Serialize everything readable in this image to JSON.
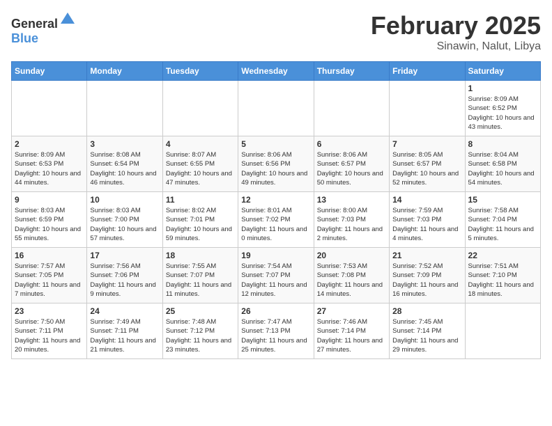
{
  "header": {
    "logo_general": "General",
    "logo_blue": "Blue",
    "month_year": "February 2025",
    "location": "Sinawin, Nalut, Libya"
  },
  "weekdays": [
    "Sunday",
    "Monday",
    "Tuesday",
    "Wednesday",
    "Thursday",
    "Friday",
    "Saturday"
  ],
  "weeks": [
    [
      {
        "day": "",
        "info": ""
      },
      {
        "day": "",
        "info": ""
      },
      {
        "day": "",
        "info": ""
      },
      {
        "day": "",
        "info": ""
      },
      {
        "day": "",
        "info": ""
      },
      {
        "day": "",
        "info": ""
      },
      {
        "day": "1",
        "info": "Sunrise: 8:09 AM\nSunset: 6:52 PM\nDaylight: 10 hours and 43 minutes."
      }
    ],
    [
      {
        "day": "2",
        "info": "Sunrise: 8:09 AM\nSunset: 6:53 PM\nDaylight: 10 hours and 44 minutes."
      },
      {
        "day": "3",
        "info": "Sunrise: 8:08 AM\nSunset: 6:54 PM\nDaylight: 10 hours and 46 minutes."
      },
      {
        "day": "4",
        "info": "Sunrise: 8:07 AM\nSunset: 6:55 PM\nDaylight: 10 hours and 47 minutes."
      },
      {
        "day": "5",
        "info": "Sunrise: 8:06 AM\nSunset: 6:56 PM\nDaylight: 10 hours and 49 minutes."
      },
      {
        "day": "6",
        "info": "Sunrise: 8:06 AM\nSunset: 6:57 PM\nDaylight: 10 hours and 50 minutes."
      },
      {
        "day": "7",
        "info": "Sunrise: 8:05 AM\nSunset: 6:57 PM\nDaylight: 10 hours and 52 minutes."
      },
      {
        "day": "8",
        "info": "Sunrise: 8:04 AM\nSunset: 6:58 PM\nDaylight: 10 hours and 54 minutes."
      }
    ],
    [
      {
        "day": "9",
        "info": "Sunrise: 8:03 AM\nSunset: 6:59 PM\nDaylight: 10 hours and 55 minutes."
      },
      {
        "day": "10",
        "info": "Sunrise: 8:03 AM\nSunset: 7:00 PM\nDaylight: 10 hours and 57 minutes."
      },
      {
        "day": "11",
        "info": "Sunrise: 8:02 AM\nSunset: 7:01 PM\nDaylight: 10 hours and 59 minutes."
      },
      {
        "day": "12",
        "info": "Sunrise: 8:01 AM\nSunset: 7:02 PM\nDaylight: 11 hours and 0 minutes."
      },
      {
        "day": "13",
        "info": "Sunrise: 8:00 AM\nSunset: 7:03 PM\nDaylight: 11 hours and 2 minutes."
      },
      {
        "day": "14",
        "info": "Sunrise: 7:59 AM\nSunset: 7:03 PM\nDaylight: 11 hours and 4 minutes."
      },
      {
        "day": "15",
        "info": "Sunrise: 7:58 AM\nSunset: 7:04 PM\nDaylight: 11 hours and 5 minutes."
      }
    ],
    [
      {
        "day": "16",
        "info": "Sunrise: 7:57 AM\nSunset: 7:05 PM\nDaylight: 11 hours and 7 minutes."
      },
      {
        "day": "17",
        "info": "Sunrise: 7:56 AM\nSunset: 7:06 PM\nDaylight: 11 hours and 9 minutes."
      },
      {
        "day": "18",
        "info": "Sunrise: 7:55 AM\nSunset: 7:07 PM\nDaylight: 11 hours and 11 minutes."
      },
      {
        "day": "19",
        "info": "Sunrise: 7:54 AM\nSunset: 7:07 PM\nDaylight: 11 hours and 12 minutes."
      },
      {
        "day": "20",
        "info": "Sunrise: 7:53 AM\nSunset: 7:08 PM\nDaylight: 11 hours and 14 minutes."
      },
      {
        "day": "21",
        "info": "Sunrise: 7:52 AM\nSunset: 7:09 PM\nDaylight: 11 hours and 16 minutes."
      },
      {
        "day": "22",
        "info": "Sunrise: 7:51 AM\nSunset: 7:10 PM\nDaylight: 11 hours and 18 minutes."
      }
    ],
    [
      {
        "day": "23",
        "info": "Sunrise: 7:50 AM\nSunset: 7:11 PM\nDaylight: 11 hours and 20 minutes."
      },
      {
        "day": "24",
        "info": "Sunrise: 7:49 AM\nSunset: 7:11 PM\nDaylight: 11 hours and 21 minutes."
      },
      {
        "day": "25",
        "info": "Sunrise: 7:48 AM\nSunset: 7:12 PM\nDaylight: 11 hours and 23 minutes."
      },
      {
        "day": "26",
        "info": "Sunrise: 7:47 AM\nSunset: 7:13 PM\nDaylight: 11 hours and 25 minutes."
      },
      {
        "day": "27",
        "info": "Sunrise: 7:46 AM\nSunset: 7:14 PM\nDaylight: 11 hours and 27 minutes."
      },
      {
        "day": "28",
        "info": "Sunrise: 7:45 AM\nSunset: 7:14 PM\nDaylight: 11 hours and 29 minutes."
      },
      {
        "day": "",
        "info": ""
      }
    ]
  ]
}
